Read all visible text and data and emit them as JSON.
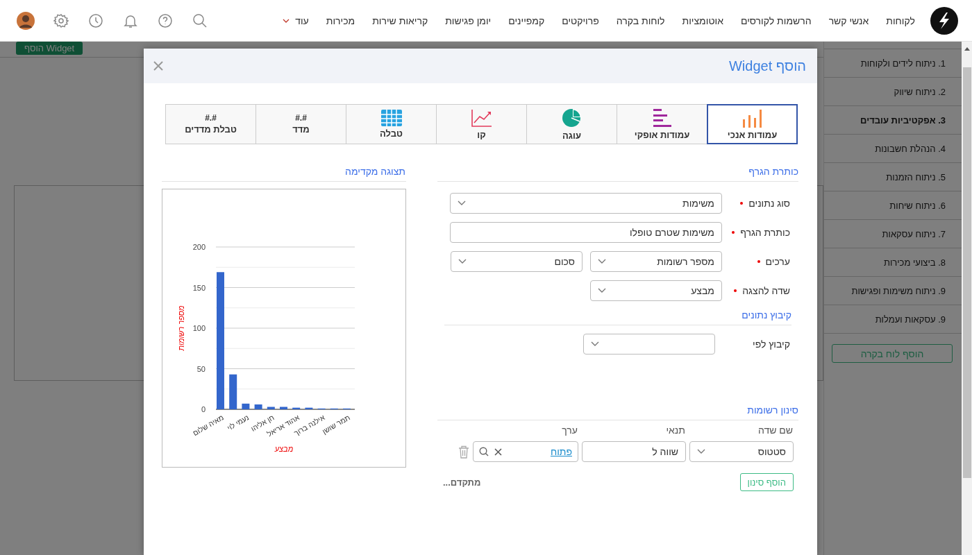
{
  "topbar": {
    "nav": [
      "לקוחות",
      "אנשי קשר",
      "הרשמות לקורסים",
      "אוטומציות",
      "לוחות בקרה",
      "פרויקטים",
      "קמפיינים",
      "יומן פגישות",
      "קריאות שירות",
      "מכירות"
    ],
    "more": "עוד"
  },
  "background": {
    "add_widget_button": "הוסף Widget"
  },
  "sidebar": {
    "items": [
      {
        "label": "1. ניתוח לידים ולקוחות",
        "selected": false
      },
      {
        "label": "2. ניתוח שיווק",
        "selected": false
      },
      {
        "label": "3. אפקטיביות עובדים",
        "selected": true
      },
      {
        "label": "4. הנהלת חשבונות",
        "selected": false
      },
      {
        "label": "5. ניתוח הזמנות",
        "selected": false
      },
      {
        "label": "6. ניתוח שיחות",
        "selected": false
      },
      {
        "label": "7. ניתוח עסקאות",
        "selected": false
      },
      {
        "label": "8. ביצועי מכירות",
        "selected": false
      },
      {
        "label": "9. ניתוח משימות ופגישות",
        "selected": false
      },
      {
        "label": "9. עסקאות ועמלות",
        "selected": false
      }
    ],
    "add_button": "הוסף לוח בקרה"
  },
  "modal": {
    "title": "הוסף Widget",
    "chart_types": [
      {
        "kind": "vbar",
        "label": "עמודות אנכי",
        "selected": true
      },
      {
        "kind": "hbar",
        "label": "עמודות אופקי",
        "selected": false
      },
      {
        "kind": "pie",
        "label": "עוגה",
        "selected": false
      },
      {
        "kind": "line",
        "label": "קו",
        "selected": false
      },
      {
        "kind": "table",
        "label": "טבלה",
        "selected": false
      },
      {
        "kind": "metric",
        "symbol": "#.#",
        "label": "מדד",
        "selected": false
      },
      {
        "kind": "metric",
        "symbol": "#.#",
        "label": "טבלת מדדים",
        "selected": false
      }
    ],
    "form": {
      "title": "כותרת הגרף",
      "fields": [
        {
          "label": "סוג נתונים",
          "required": true,
          "controls": [
            {
              "kind": "wide_select",
              "value": "משימות"
            }
          ]
        },
        {
          "label": "כותרת הגרף",
          "required": true,
          "controls": [
            {
              "kind": "wide_input",
              "value": "משימות שטרם טופלו"
            }
          ]
        },
        {
          "label": "ערכים",
          "required": true,
          "controls": [
            {
              "kind": "select",
              "value": "מספר רשומות"
            },
            {
              "kind": "select",
              "value": "סכום"
            }
          ]
        },
        {
          "label": "שדה להצגה",
          "required": true,
          "controls": [
            {
              "kind": "select",
              "value": "מבצע"
            }
          ]
        }
      ]
    },
    "grouping": {
      "title": "קיבוץ נתונים",
      "fields": [
        {
          "label": "קיבוץ לפי",
          "required": false,
          "controls": [
            {
              "kind": "select"
            }
          ]
        }
      ]
    },
    "filter": {
      "title": "סינון רשומות",
      "columns": [
        "שם שדה",
        "תנאי",
        "ערך"
      ],
      "rows": [
        {
          "field": "סטטוס",
          "condition": "שווה ל",
          "value": "פתוח"
        }
      ],
      "add_button": "הוסף סינון",
      "advanced": "מתקדם..."
    },
    "preview": {
      "title": "תצוגה מקדימה",
      "chart_data": {
        "type": "bar",
        "xlabel": "מבצע",
        "ylabel": "מספר רשומות",
        "categories": [
          "מאיה שלום",
          null,
          "נעמי לוי",
          null,
          "חן אליהו",
          null,
          "אהוד אריאל",
          null,
          "אילנה ברוך",
          null,
          "תמר שושן"
        ],
        "values": [
          169,
          43,
          7,
          6,
          3,
          3,
          2,
          2,
          1,
          1,
          1
        ],
        "ylim": [
          0,
          200
        ],
        "yticks": [
          0,
          50,
          100,
          150,
          200
        ],
        "grid": true
      }
    }
  }
}
